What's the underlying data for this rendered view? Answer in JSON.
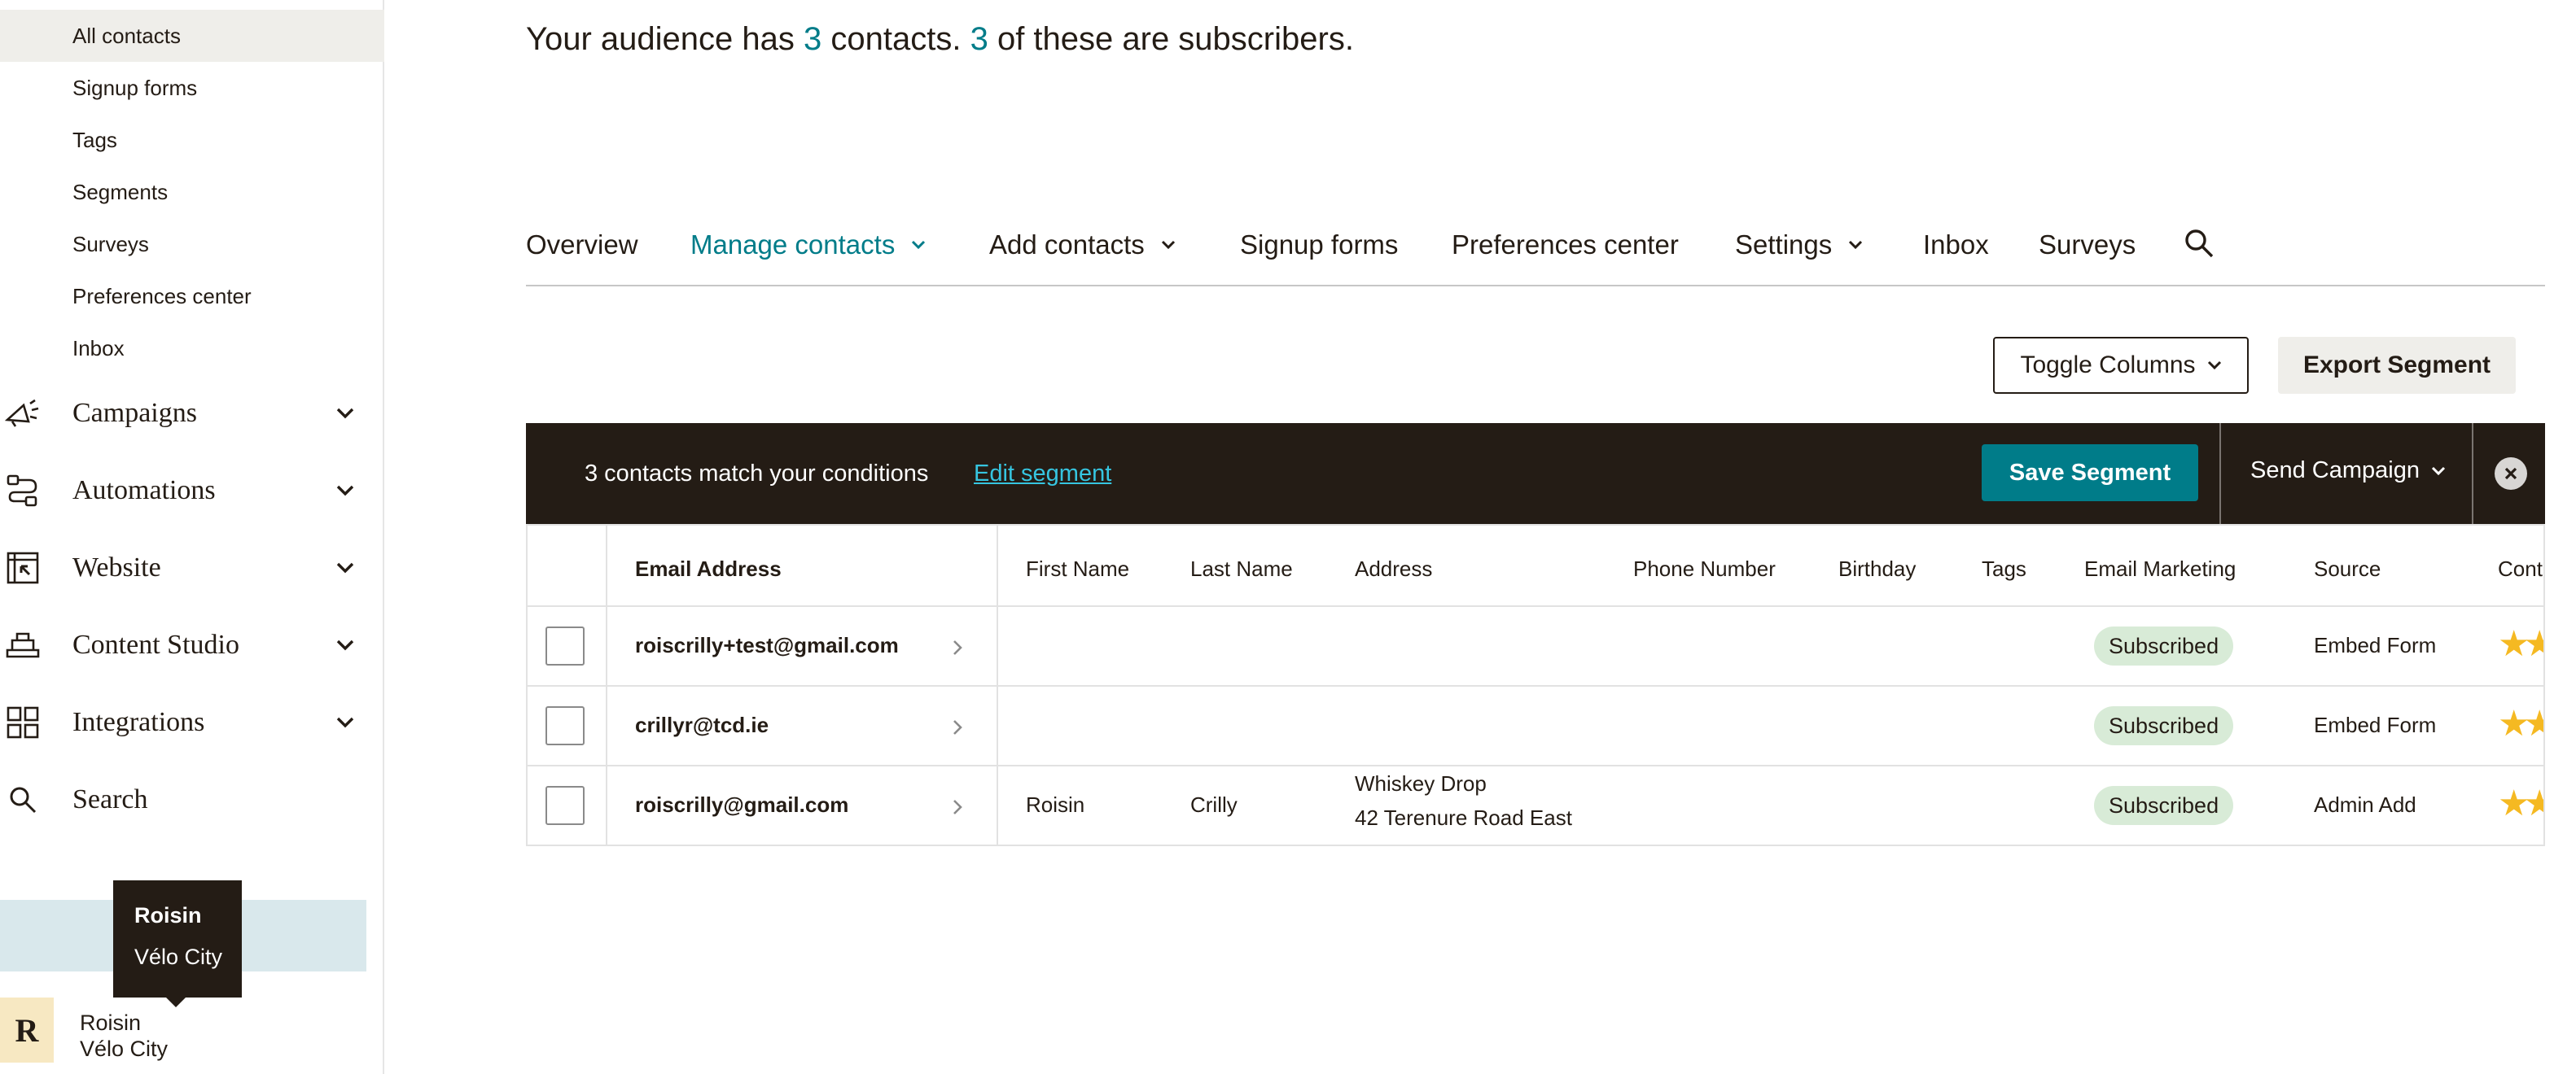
{
  "sidebar": {
    "sub_items": [
      {
        "label": "All contacts",
        "active": true
      },
      {
        "label": "Signup forms"
      },
      {
        "label": "Tags"
      },
      {
        "label": "Segments"
      },
      {
        "label": "Surveys"
      },
      {
        "label": "Preferences center"
      },
      {
        "label": "Inbox"
      }
    ],
    "nav_items": [
      {
        "label": "Campaigns",
        "icon": "megaphone-icon",
        "has_chevron": true
      },
      {
        "label": "Automations",
        "icon": "automation-icon",
        "has_chevron": true
      },
      {
        "label": "Website",
        "icon": "website-icon",
        "has_chevron": true
      },
      {
        "label": "Content Studio",
        "icon": "content-studio-icon",
        "has_chevron": true
      },
      {
        "label": "Integrations",
        "icon": "grid-icon",
        "has_chevron": true
      },
      {
        "label": "Search",
        "icon": "search-icon",
        "has_chevron": false
      }
    ],
    "tooltip": {
      "name": "Roisin",
      "org": "Vélo City"
    },
    "account": {
      "avatar_letter": "R",
      "name": "Roisin",
      "org": "Vélo City"
    }
  },
  "summary": {
    "prefix": "Your audience has ",
    "contacts": "3",
    "middle": " contacts. ",
    "subscribers": "3",
    "suffix": " of these are subscribers."
  },
  "tabs": [
    {
      "label": "Overview",
      "active": false,
      "chevron": false
    },
    {
      "label": "Manage contacts",
      "active": true,
      "chevron": true
    },
    {
      "label": "Add contacts",
      "active": false,
      "chevron": true
    },
    {
      "label": "Signup forms",
      "active": false,
      "chevron": false
    },
    {
      "label": "Preferences center",
      "active": false,
      "chevron": false
    },
    {
      "label": "Settings",
      "active": false,
      "chevron": true
    },
    {
      "label": "Inbox",
      "active": false,
      "chevron": false
    },
    {
      "label": "Surveys",
      "active": false,
      "chevron": false
    }
  ],
  "toolbar": {
    "toggle_columns": "Toggle Columns",
    "export_segment": "Export Segment"
  },
  "segment_bar": {
    "match_text": "3 contacts match your conditions",
    "edit_link": "Edit segment",
    "save_button": "Save Segment",
    "send_campaign": "Send Campaign"
  },
  "table": {
    "headers": {
      "email": "Email Address",
      "first_name": "First Name",
      "last_name": "Last Name",
      "address": "Address",
      "phone": "Phone Number",
      "birthday": "Birthday",
      "tags": "Tags",
      "email_marketing": "Email Marketing",
      "source": "Source",
      "contact_rating": "Cont"
    },
    "rows": [
      {
        "email": "roiscrilly+test@gmail.com",
        "first_name": "",
        "last_name": "",
        "address_line1": "",
        "address_line2": "",
        "status": "Subscribed",
        "source": "Embed Form",
        "rating_stars": "★★"
      },
      {
        "email": "crillyr@tcd.ie",
        "first_name": "",
        "last_name": "",
        "address_line1": "",
        "address_line2": "",
        "status": "Subscribed",
        "source": "Embed Form",
        "rating_stars": "★★"
      },
      {
        "email": "roiscrilly@gmail.com",
        "first_name": "Roisin",
        "last_name": "Crilly",
        "address_line1": "Whiskey Drop",
        "address_line2": "42 Terenure Road East",
        "status": "Subscribed",
        "source": "Admin Add",
        "rating_stars": "★★"
      }
    ]
  },
  "colors": {
    "accent": "#007c89",
    "dark": "#241c15",
    "badge": "#d8ebd7",
    "star": "#f5b922",
    "link": "#36c5e0"
  }
}
